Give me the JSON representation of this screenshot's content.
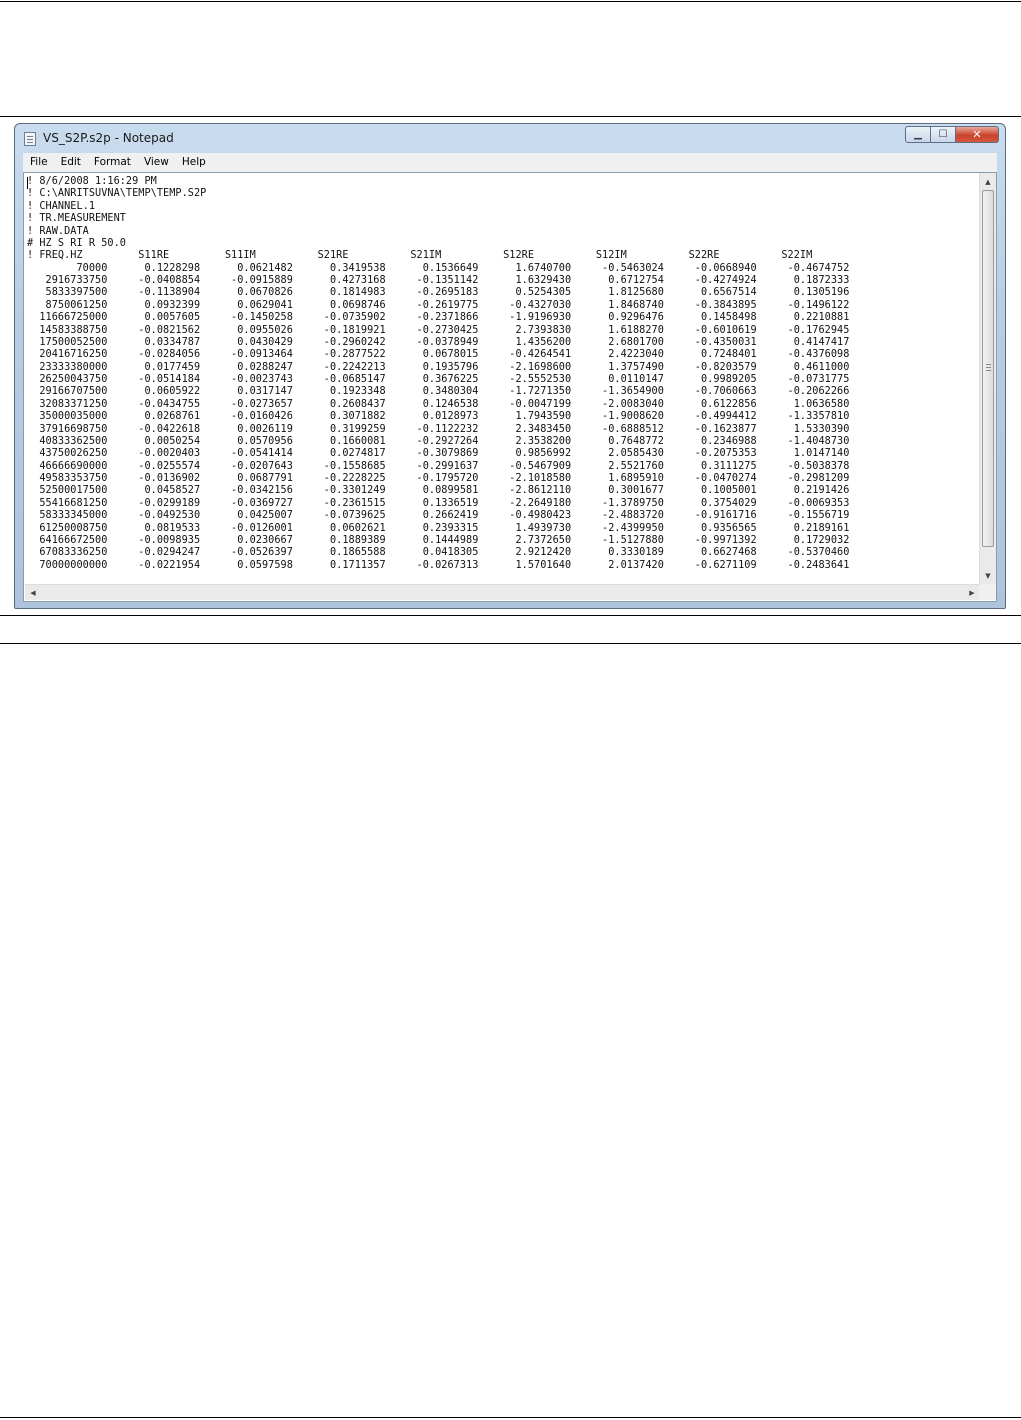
{
  "window": {
    "title": "VS_S2P.s2p - Notepad",
    "controls": {
      "minimize": "▁",
      "maximize": "☐",
      "close": "✕"
    }
  },
  "menu": {
    "items": [
      "File",
      "Edit",
      "Format",
      "View",
      "Help"
    ]
  },
  "document": {
    "header_lines": [
      "! 8/6/2008 1:16:29 PM",
      "! C:\\ANRITSUVNA\\TEMP\\TEMP.S2P",
      "! CHANNEL.1",
      "! TR.MEASUREMENT",
      "! RAW.DATA",
      "# HZ S RI R 50.0"
    ],
    "column_header": "! FREQ.HZ         S11RE         S11IM          S21RE          S21IM          S12RE          S12IM          S22RE          S22IM",
    "data_rows": [
      "        70000      0.1228298      0.0621482      0.3419538      0.1536649      1.6740700     -0.5463024     -0.0668940     -0.4674752",
      "   2916733750     -0.0408854     -0.0915889      0.4273168     -0.1351142      1.6329430      0.6712754     -0.4274924      0.1872333",
      "   5833397500     -0.1138904      0.0670826      0.1814983     -0.2695183      0.5254305      1.8125680      0.6567514      0.1305196",
      "   8750061250      0.0932399      0.0629041      0.0698746     -0.2619775     -0.4327030      1.8468740     -0.3843895     -0.1496122",
      "  11666725000      0.0057605     -0.1450258     -0.0735902     -0.2371866     -1.9196930      0.9296476      0.1458498      0.2210881",
      "  14583388750     -0.0821562      0.0955026     -0.1819921     -0.2730425      2.7393830      1.6188270     -0.6010619     -0.1762945",
      "  17500052500      0.0334787      0.0430429     -0.2960242     -0.0378949      1.4356200      2.6801700     -0.4350031      0.4147417",
      "  20416716250     -0.0284056     -0.0913464     -0.2877522      0.0678015     -0.4264541      2.4223040      0.7248401     -0.4376098",
      "  23333380000      0.0177459      0.0288247     -0.2242213      0.1935796     -2.1698600      1.3757490     -0.8203579      0.4611000",
      "  26250043750     -0.0514184     -0.0023743     -0.0685147      0.3676225     -2.5552530      0.0110147      0.9989205     -0.0731775",
      "  29166707500      0.0605922      0.0317147      0.1923348      0.3480304     -1.7271350     -1.3654900     -0.7060663     -0.2062266",
      "  32083371250     -0.0434755     -0.0273657      0.2608437      0.1246538     -0.0047199     -2.0083040      0.6122856      1.0636580",
      "  35000035000      0.0268761     -0.0160426      0.3071882      0.0128973      1.7943590     -1.9008620     -0.4994412     -1.3357810",
      "  37916698750     -0.0422618      0.0026119      0.3199259     -0.1122232      2.3483450     -0.6888512     -0.1623877      1.5330390",
      "  40833362500      0.0050254      0.0570956      0.1660081     -0.2927264      2.3538200      0.7648772      0.2346988     -1.4048730",
      "  43750026250     -0.0020403     -0.0541414      0.0274817     -0.3079869      0.9856992      2.0585430     -0.2075353      1.0147140",
      "  46666690000     -0.0255574     -0.0207643     -0.1558685     -0.2991637     -0.5467909      2.5521760      0.3111275     -0.5038378",
      "  49583353750     -0.0136902      0.0687791     -0.2228225     -0.1795720     -2.1018580      1.6895910     -0.0470274     -0.2981209",
      "  52500017500      0.0458527     -0.0342156     -0.3301249      0.0899581     -2.8612110      0.3001677      0.1005001      0.2191426",
      "  55416681250     -0.0299189     -0.0369727     -0.2361515      0.1336519     -2.2649180     -1.3789750      0.3754029     -0.0069353",
      "  58333345000     -0.0492530      0.0425007     -0.0739625      0.2662419     -0.4980423     -2.4883720     -0.9161716     -0.1556719",
      "  61250008750      0.0819533     -0.0126001      0.0602621      0.2393315      1.4939730     -2.4399950      0.9356565      0.2189161",
      "  64166672500     -0.0098935      0.0230667      0.1889389      0.1444989      2.7372650     -1.5127880     -0.9971392      0.1729032",
      "  67083336250     -0.0294247     -0.0526397      0.1865588      0.0418305      2.9212420      0.3330189      0.6627468     -0.5370460",
      "  70000000000     -0.0221954      0.0597598      0.1711357     -0.0267313      1.5701640      2.0137420     -0.6271109     -0.2483641"
    ]
  }
}
